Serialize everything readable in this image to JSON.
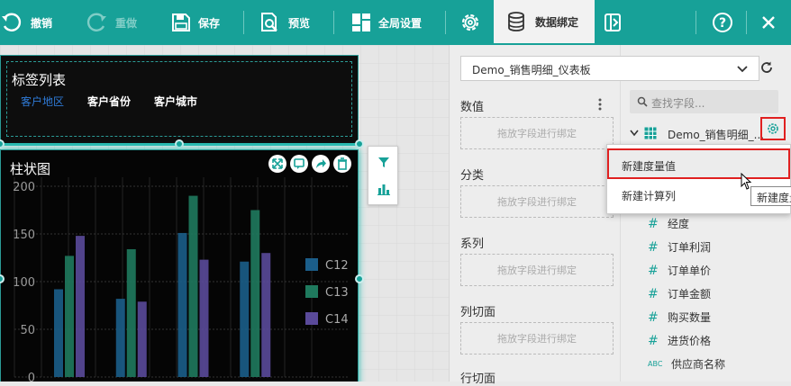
{
  "toolbar": {
    "undo": "撤销",
    "redo": "重做",
    "save": "保存",
    "preview": "预览",
    "global_settings": "全局设置",
    "data_binding": "数据绑定"
  },
  "tag_widget": {
    "title": "标签列表",
    "tags": [
      "客户地区",
      "客户省份",
      "客户城市"
    ],
    "active_tag_color": "#2f7bd8"
  },
  "chart_widget": {
    "title": "柱状图"
  },
  "chart_data": {
    "type": "bar",
    "categories": [
      "",
      "",
      "",
      ""
    ],
    "series": [
      {
        "name": "C12",
        "values": [
          92,
          82,
          151,
          121
        ],
        "color": "#1b5e8a"
      },
      {
        "name": "C13",
        "values": [
          127,
          134,
          190,
          175
        ],
        "color": "#1f7a5e"
      },
      {
        "name": "C14",
        "values": [
          148,
          79,
          123,
          130
        ],
        "color": "#5a4a9a"
      }
    ],
    "y_ticks": [
      "200",
      "150",
      "100",
      "50",
      "0"
    ],
    "ylim": [
      0,
      200
    ],
    "grid": true,
    "legend": "right"
  },
  "binding": {
    "dataset": "Demo_销售明细_仪表板",
    "sections": [
      {
        "label": "数值",
        "placeholder": "拖放字段进行绑定"
      },
      {
        "label": "分类",
        "placeholder": "拖放字段进行绑定"
      },
      {
        "label": "系列",
        "placeholder": "拖放字段进行绑定"
      },
      {
        "label": "列切面",
        "placeholder": "拖放字段进行绑定"
      },
      {
        "label": "行切面"
      }
    ]
  },
  "fields": {
    "search_placeholder": "查找字段...",
    "dataset_node": "Demo_销售明细_...",
    "items": [
      {
        "type": "#",
        "name": "经度"
      },
      {
        "type": "#",
        "name": "订单利润"
      },
      {
        "type": "#",
        "name": "订单单价"
      },
      {
        "type": "#",
        "name": "订单金额"
      },
      {
        "type": "#",
        "name": "购买数量"
      },
      {
        "type": "#",
        "name": "进货价格"
      },
      {
        "type": "ABC",
        "name": "供应商名称"
      }
    ]
  },
  "context_menu": {
    "items": [
      "新建度量值",
      "新建计算列"
    ]
  },
  "tooltip": "新建度量值",
  "colors": {
    "accent": "#17a198",
    "highlight_border": "#e02020"
  }
}
